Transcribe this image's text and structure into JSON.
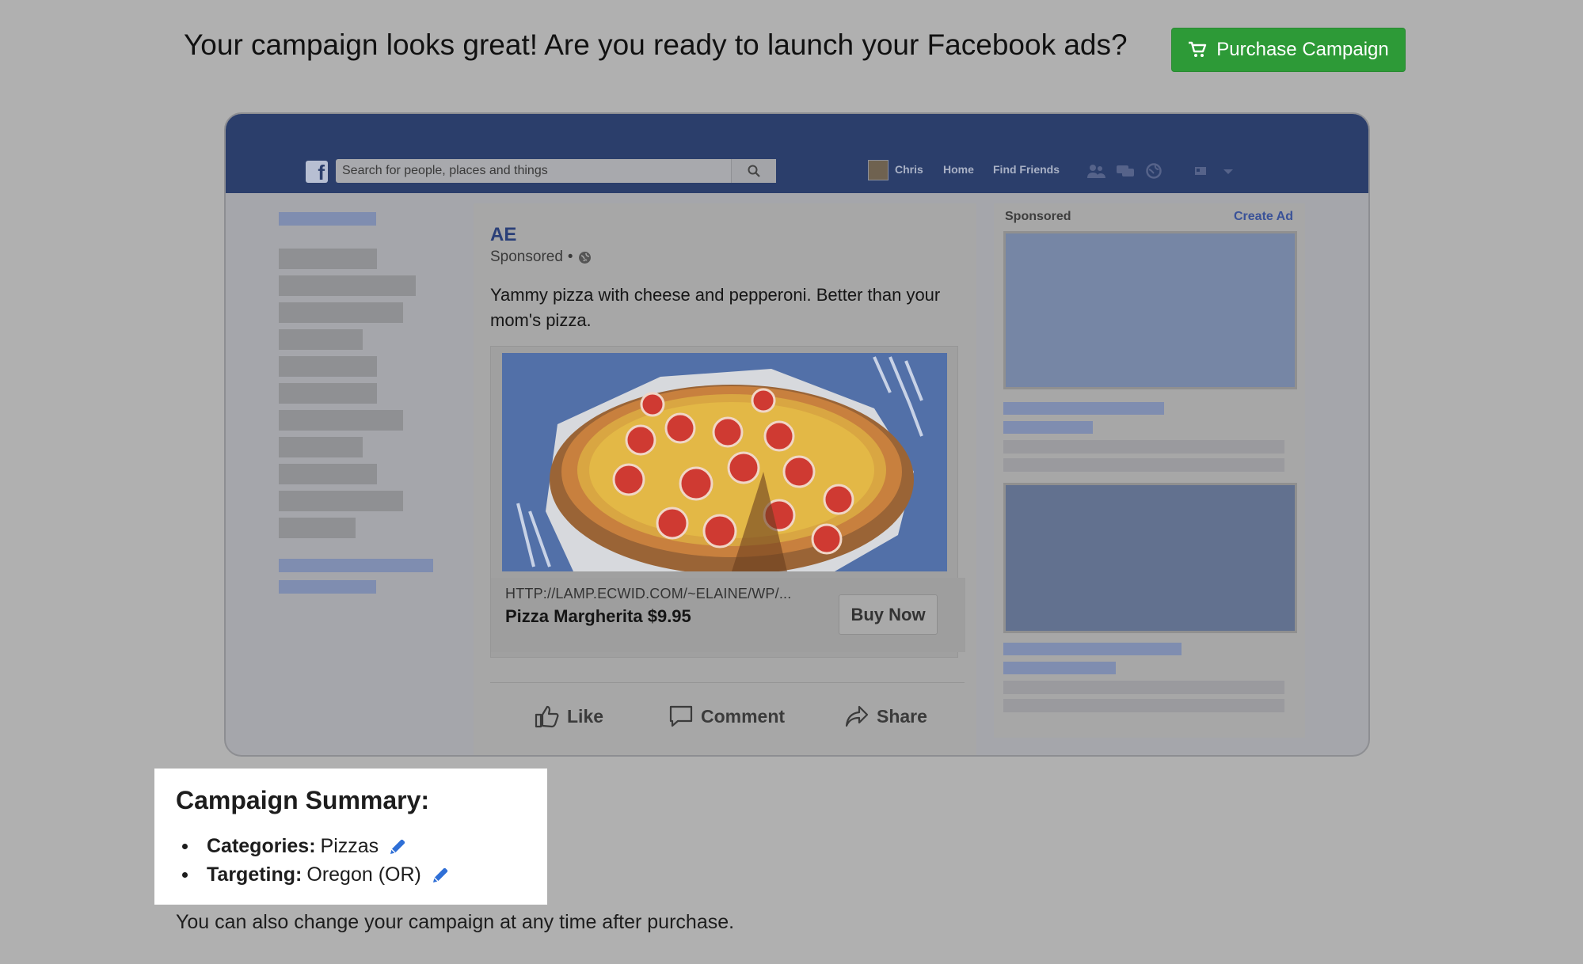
{
  "header": {
    "headline": "Your campaign looks great! Are you ready to launch your Facebook ads?",
    "purchase_label": "Purchase Campaign",
    "purchase_color": "#2d9a37"
  },
  "facebook_preview": {
    "search_placeholder": "Search for people, places and things",
    "nav": {
      "user_name": "Chris",
      "home": "Home",
      "find_friends": "Find Friends"
    },
    "post": {
      "author": "AE",
      "sponsored_label": "Sponsored",
      "sponsored_separator": "•",
      "text": "Yammy pizza with cheese and pepperoni. Better than your mom's pizza.",
      "link_url": "HTTP://LAMP.ECWID.COM/~ELAINE/WP/...",
      "link_title": "Pizza Margherita $9.95",
      "buy_now_label": "Buy Now",
      "actions": {
        "like": "Like",
        "comment": "Comment",
        "share": "Share"
      }
    },
    "right_column": {
      "sponsored_label": "Sponsored",
      "create_ad_label": "Create Ad"
    }
  },
  "summary": {
    "title": "Campaign Summary:",
    "items": [
      {
        "label": "Categories:",
        "value": "Pizzas"
      },
      {
        "label": "Targeting:",
        "value": "Oregon (OR)"
      }
    ],
    "footnote": "You can also change your campaign at any time after purchase."
  },
  "colors": {
    "overlay_background": "#b0b0b0",
    "facebook_bar": "#2b3e6b",
    "edit_icon": "#2f6fd6"
  }
}
